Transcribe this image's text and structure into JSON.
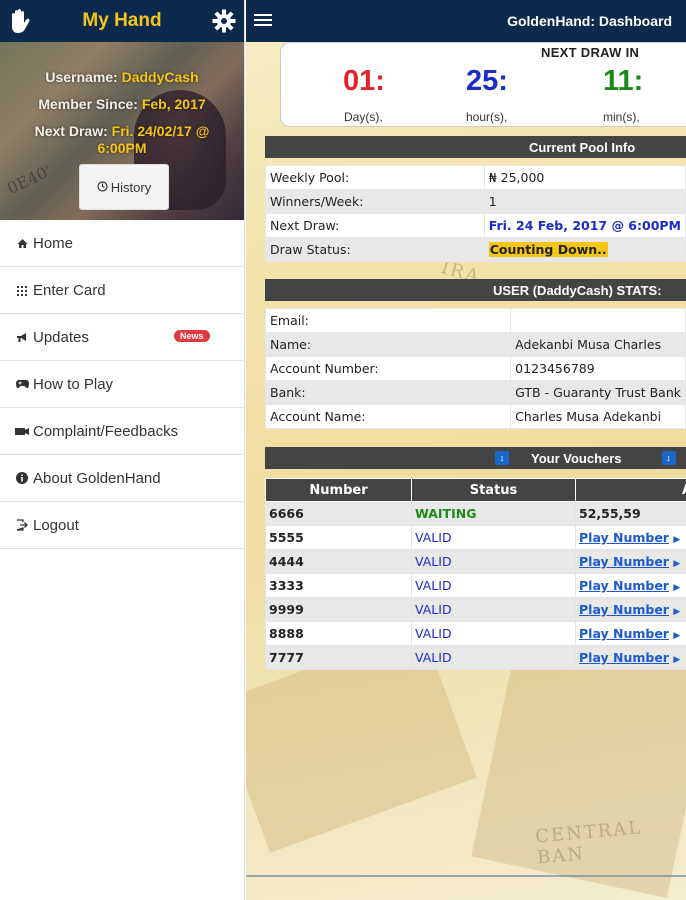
{
  "sidebar": {
    "app_title": "My Hand",
    "profile": {
      "username_label": "Username: ",
      "username": "DaddyCash",
      "member_since_label": "Member Since: ",
      "member_since": "Feb, 2017",
      "next_draw_label": "Next Draw: ",
      "next_draw": "Fri. 24/02/17 @ 6:00PM",
      "history_button": "History"
    },
    "menu": [
      {
        "label": "Home",
        "icon": "home-icon"
      },
      {
        "label": "Enter Card",
        "icon": "grid-icon"
      },
      {
        "label": "Updates",
        "icon": "megaphone-icon",
        "badge": "News"
      },
      {
        "label": "How to Play",
        "icon": "gamepad-icon"
      },
      {
        "label": "Complaint/Feedbacks",
        "icon": "camera-icon"
      },
      {
        "label": "About GoldenHand",
        "icon": "info-icon"
      },
      {
        "label": "Logout",
        "icon": "logout-icon"
      }
    ]
  },
  "header": {
    "title": "GoldenHand: Dashboard"
  },
  "countdown": {
    "title": "NEXT DRAW IN",
    "days": "01:",
    "days_label": "Day(s),",
    "hours": "25:",
    "hours_label": "hour(s),",
    "mins": "11:",
    "mins_label": "min(s),",
    "colors": {
      "days": "#e8202a",
      "hours": "#1b2cc7",
      "mins": "#1a8a1a"
    }
  },
  "pool": {
    "heading": "Current Pool Info",
    "rows": [
      {
        "key": "Weekly Pool:",
        "value": "₦ 25,000"
      },
      {
        "key": "Winners/Week:",
        "value": "1"
      },
      {
        "key": "Next Draw:",
        "value": "Fri. 24 Feb, 2017 @ 6:00PM"
      },
      {
        "key": "Draw Status:",
        "value": "Counting Down.."
      }
    ]
  },
  "user_stats": {
    "heading": "USER (DaddyCash) STATS:",
    "rows": [
      {
        "key": "Email:",
        "value": ""
      },
      {
        "key": "Name:",
        "value": "Adekanbi Musa Charles"
      },
      {
        "key": "Account Number:",
        "value": "0123456789"
      },
      {
        "key": "Bank:",
        "value": "GTB - Guaranty Trust Bank"
      },
      {
        "key": "Account Name:",
        "value": "Charles Musa Adekanbi"
      }
    ]
  },
  "vouchers": {
    "heading": "Your Vouchers",
    "columns": [
      "Number",
      "Status",
      "A"
    ],
    "rows": [
      {
        "number": "6666",
        "status": "WAITING",
        "action": "52,55,59"
      },
      {
        "number": "5555",
        "status": "VALID",
        "action": "Play Number"
      },
      {
        "number": "4444",
        "status": "VALID",
        "action": "Play Number"
      },
      {
        "number": "3333",
        "status": "VALID",
        "action": "Play Number"
      },
      {
        "number": "9999",
        "status": "VALID",
        "action": "Play Number"
      },
      {
        "number": "8888",
        "status": "VALID",
        "action": "Play Number"
      },
      {
        "number": "7777",
        "status": "VALID",
        "action": "Play Number"
      }
    ]
  },
  "colors": {
    "navy": "#0d2a4e",
    "gold": "#f5c518",
    "badge_red": "#e0393e"
  }
}
